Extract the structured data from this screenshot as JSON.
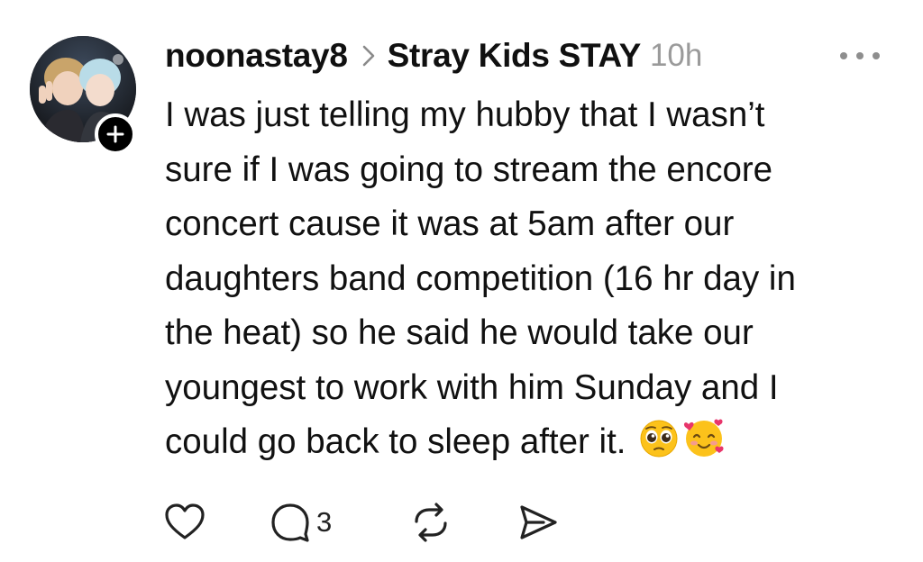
{
  "post": {
    "username": "noonastay8",
    "community": "Stray Kids STAY",
    "time": "10h",
    "body_lines": [
      "I was just telling my hubby that I wasn’t",
      "sure if I was going to stream the encore",
      "concert cause it was at 5am after our",
      "daughters band competition (16 hr day in",
      "the heat) so he said he would take our",
      "youngest to work with him Sunday and I",
      "could go back to sleep after it."
    ],
    "emojis": [
      "pleading-face",
      "smiling-face-with-hearts"
    ]
  },
  "actions": {
    "reply_count": "3"
  },
  "icons": {
    "avatar": "avatar-photo",
    "follow": "plus-icon",
    "separator": "chevron-right-icon",
    "more": "more-horizontal-icon",
    "like": "heart-icon",
    "reply": "comment-icon",
    "repost": "repost-icon",
    "share": "send-icon"
  },
  "colors": {
    "text": "#111111",
    "muted": "#9a9a9a",
    "background": "#ffffff"
  }
}
